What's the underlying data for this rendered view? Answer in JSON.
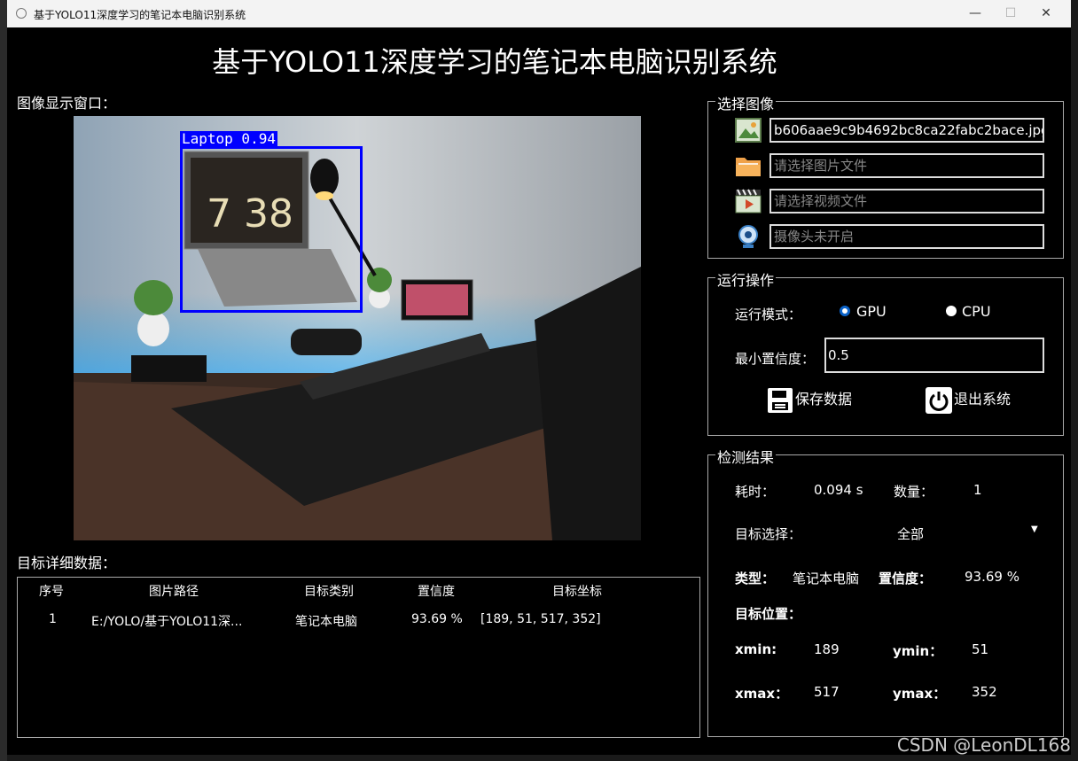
{
  "window": {
    "title": "基于YOLO11深度学习的笔记本电脑识别系统",
    "minimize": "—",
    "maximize": "☐",
    "close": "✕"
  },
  "app_title": "基于YOLO11深度学习的笔记本电脑识别系统",
  "image_panel": {
    "label": "图像显示窗口：",
    "detection_label": "Laptop 0.94",
    "clock_text": "7 38"
  },
  "table": {
    "label": "目标详细数据：",
    "headers": [
      "序号",
      "图片路径",
      "目标类别",
      "置信度",
      "目标坐标"
    ],
    "rows": [
      [
        "1",
        "E:/YOLO/基于YOLO11深...",
        "笔记本电脑",
        "93.69 %",
        "[189, 51, 517, 352]"
      ]
    ]
  },
  "select_image": {
    "title": "选择图像",
    "image_path": "b606aae9c9b4692bc8ca22fabc2bace.jpg",
    "image_file_placeholder": "请选择图片文件",
    "video_file_placeholder": "请选择视频文件",
    "camera_placeholder": "摄像头未开启",
    "icons": [
      "image-icon",
      "folder-icon",
      "video-icon",
      "webcam-icon"
    ]
  },
  "run_ops": {
    "title": "运行操作",
    "mode_label": "运行模式：",
    "gpu_label": "GPU",
    "cpu_label": "CPU",
    "selected_mode": "GPU",
    "min_conf_label": "最小置信度：",
    "min_conf_value": "0.5",
    "save_label": "保存数据",
    "exit_label": "退出系统"
  },
  "results": {
    "title": "检测结果",
    "time_label": "耗时：",
    "time_value": "0.094 s",
    "count_label": "数量：",
    "count_value": "1",
    "target_select_label": "目标选择：",
    "target_select_value": "全部",
    "type_label": "类型：",
    "type_value": "笔记本电脑",
    "conf_label": "置信度：",
    "conf_value": "93.69 %",
    "position_label": "目标位置：",
    "xmin_label": "xmin:",
    "xmin_value": "189",
    "ymin_label": "ymin：",
    "ymin_value": "51",
    "xmax_label": "xmax：",
    "xmax_value": "517",
    "ymax_label": "ymax：",
    "ymax_value": "352"
  },
  "watermark": "CSDN @LeonDL168",
  "colors": {
    "background": "#000000",
    "detection_box": "#0000ff",
    "radio_accent": "#0b63c9"
  }
}
